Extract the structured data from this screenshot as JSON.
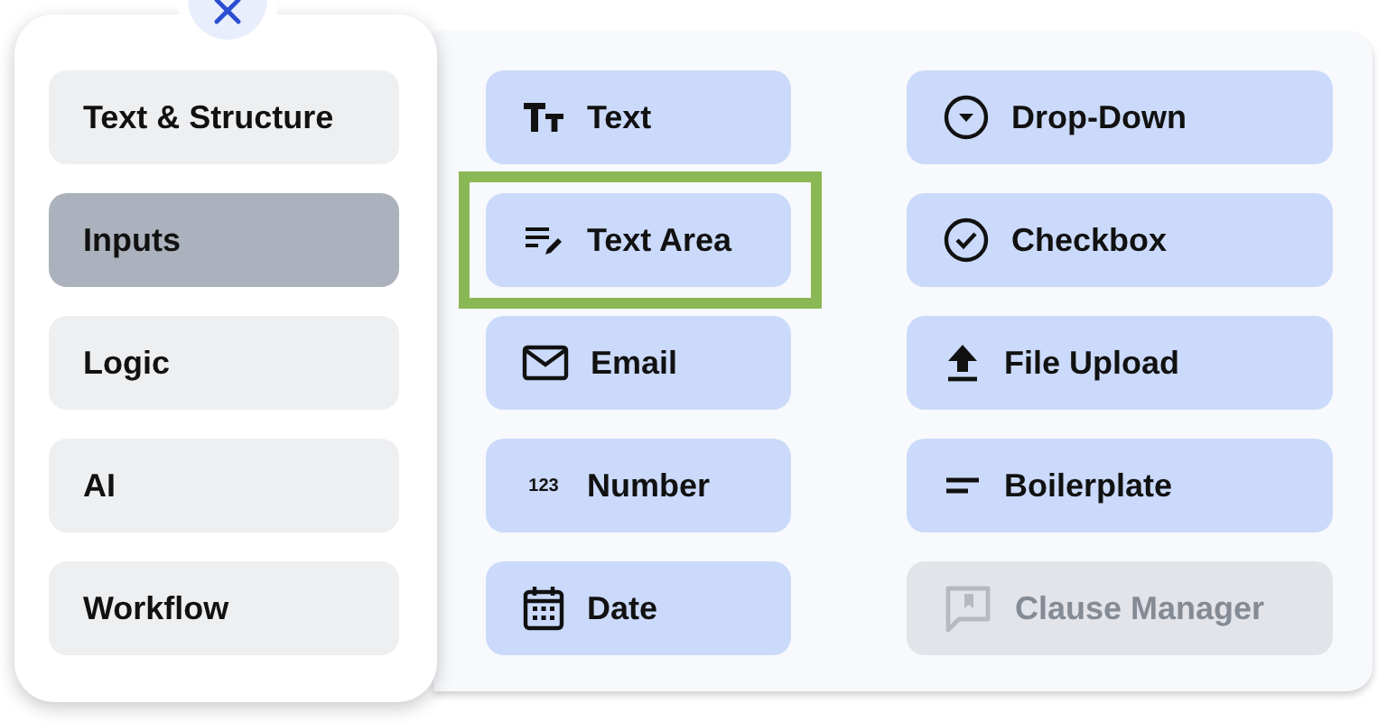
{
  "categories": [
    {
      "label": "Text & Structure",
      "selected": false
    },
    {
      "label": "Inputs",
      "selected": true
    },
    {
      "label": "Logic",
      "selected": false
    },
    {
      "label": "AI",
      "selected": false
    },
    {
      "label": "Workflow",
      "selected": false
    }
  ],
  "columns": [
    [
      {
        "kind": "text",
        "label": "Text",
        "disabled": false,
        "highlighted": false
      },
      {
        "kind": "textarea",
        "label": "Text Area",
        "disabled": false,
        "highlighted": true
      },
      {
        "kind": "email",
        "label": "Email",
        "disabled": false,
        "highlighted": false
      },
      {
        "kind": "number",
        "icon_text": "123",
        "label": "Number",
        "disabled": false,
        "highlighted": false
      },
      {
        "kind": "date",
        "label": "Date",
        "disabled": false,
        "highlighted": false
      }
    ],
    [
      {
        "kind": "dropdown",
        "label": "Drop-Down",
        "disabled": false,
        "highlighted": false
      },
      {
        "kind": "checkbox",
        "label": "Checkbox",
        "disabled": false,
        "highlighted": false
      },
      {
        "kind": "upload",
        "label": "File Upload",
        "disabled": false,
        "highlighted": false
      },
      {
        "kind": "boilerplate",
        "label": "Boilerplate",
        "disabled": false,
        "highlighted": false
      },
      {
        "kind": "clause",
        "label": "Clause Manager",
        "disabled": true,
        "highlighted": false
      }
    ]
  ]
}
